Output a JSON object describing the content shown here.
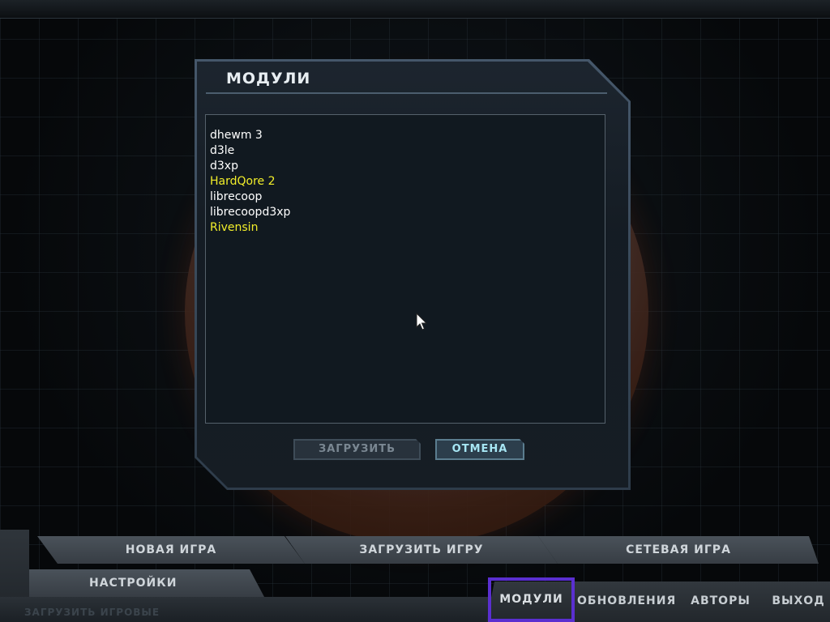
{
  "dialog": {
    "title": "МОДУЛИ",
    "mods": [
      {
        "name": "dhewm 3",
        "highlight": false
      },
      {
        "name": "d3le",
        "highlight": false
      },
      {
        "name": "d3xp",
        "highlight": false
      },
      {
        "name": "HardQore 2",
        "highlight": true
      },
      {
        "name": "librecoop",
        "highlight": false
      },
      {
        "name": "librecoopd3xp",
        "highlight": false
      },
      {
        "name": "Rivensin",
        "highlight": true
      }
    ],
    "load_button": "ЗАГРУЗИТЬ",
    "cancel_button": "ОТМЕНА"
  },
  "main_menu": {
    "new_game": "НОВАЯ ИГРА",
    "load_game": "ЗАГРУЗИТЬ ИГРУ",
    "network_game": "СЕТЕВАЯ ИГРА",
    "settings": "НАСТРОЙКИ",
    "load_hint": "ЗАГРУЗИТЬ ИГРОВЫЕ",
    "mods": "МОДУЛИ",
    "updates": "ОБНОВЛЕНИЯ",
    "authors": "АВТОРЫ",
    "exit": "ВЫХОД"
  },
  "colors": {
    "highlight_text": "#f2ee2a",
    "normal_text": "#ffffff",
    "selection_outline": "#5a2fd0"
  }
}
